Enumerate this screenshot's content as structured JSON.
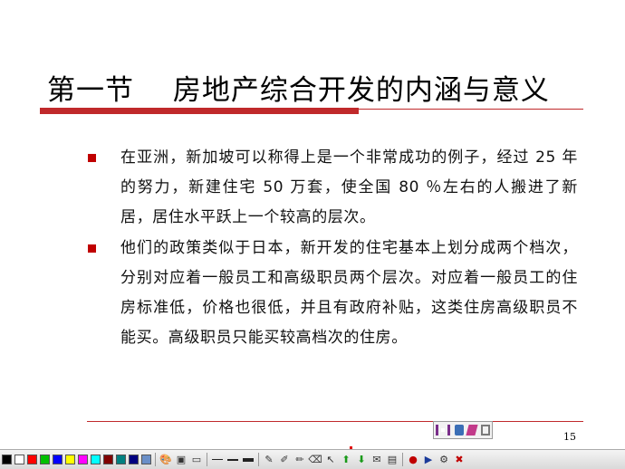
{
  "slide": {
    "title": "第一节　 房地产综合开发的内涵与意义",
    "paragraphs": [
      "在亚洲，新加坡可以称得上是一个非常成功的例子，经过 25 年的努力，新建住宅 50 万套，使全国 80 ％左右的人搬进了新居，居住水平跃上一个较高的层次。",
      "他们的政策类似于日本，新开发的住宅基本上划分成两个档次，分别对应着一般员工和高级职员两个层次。对应着一般员工的住房标准低，价格也很低，并且有政府补贴，这类住房高级职员不能买。高级职员只能买较高档次的住房。"
    ],
    "page_number": "15"
  },
  "colors": {
    "accent": "#c0292b",
    "bullet": "#c00000"
  },
  "toolbar": {
    "swatches": [
      "#000000",
      "#ffffff",
      "#ff0000",
      "#00c000",
      "#0000ff",
      "#ffff00",
      "#ff00ff",
      "#00ffff",
      "#800000",
      "#008080",
      "#000080",
      "#6a8fc8"
    ],
    "icons": [
      "pen-icon",
      "brush-icon",
      "eraser-icon",
      "pointer-icon",
      "arrow-up-icon",
      "arrow-down-icon",
      "email-icon",
      "save-icon",
      "record-icon",
      "play-icon",
      "exit-icon"
    ]
  }
}
